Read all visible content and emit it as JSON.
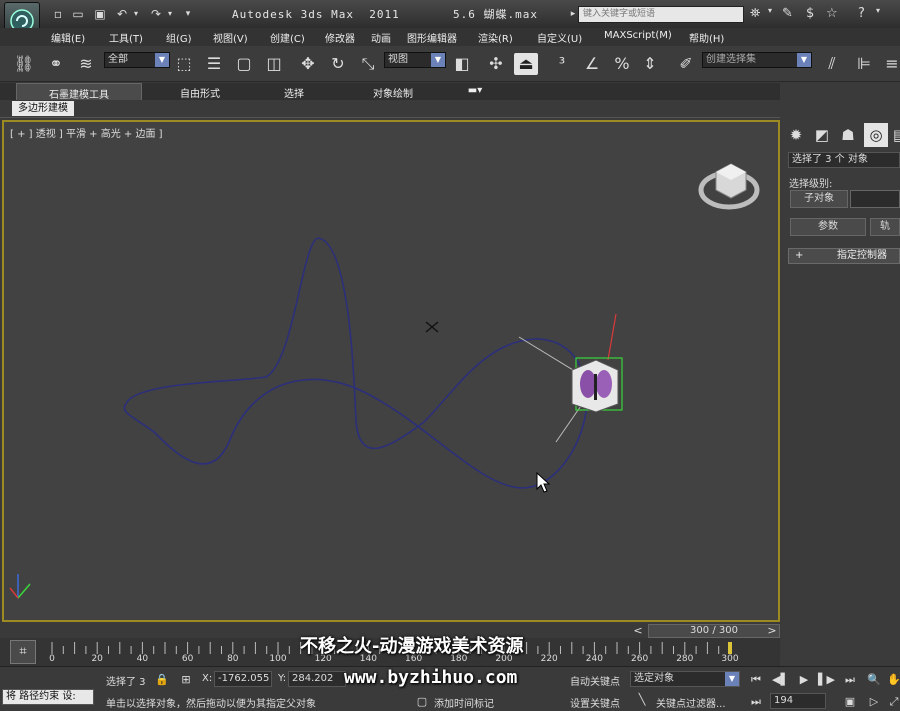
{
  "window": {
    "title": "Autodesk 3ds Max  2011       5.6 蝴蝶.max",
    "search_placeholder": "键入关键字或短语"
  },
  "menubar": [
    "编辑(E)",
    "工具(T)",
    "组(G)",
    "视图(V)",
    "创建(C)",
    "修改器",
    "动画",
    "图形编辑器",
    "渲染(R)",
    "自定义(U)",
    "MAXScript(M)",
    "帮助(H)"
  ],
  "toolbar": {
    "filter_value": "全部",
    "refcoord_value": "视图",
    "selection_set_placeholder": "创建选择集"
  },
  "ribbon": {
    "tabs": [
      "石墨建模工具",
      "自由形式",
      "选择",
      "对象绘制"
    ],
    "subtab": "多边形建模"
  },
  "viewport": {
    "label": "[ + ] 透视 ] 平滑 + 高光 + 边面 ]"
  },
  "command_panel": {
    "selection_text": "选择了 3 个 对象",
    "sublevel_label": "选择级别:",
    "subobject_button": "子对象",
    "params_button": "参数",
    "track_button": "轨",
    "rollout_title": "指定控制器"
  },
  "timeline": {
    "frame_display": "300 / 300",
    "ticks": [
      "0",
      "20",
      "40",
      "60",
      "80",
      "100",
      "120",
      "140",
      "160",
      "180",
      "200",
      "220",
      "240",
      "260",
      "280",
      "300"
    ]
  },
  "status": {
    "maxscript_text": "将 路径约束 设:",
    "selected_text": "选择了 3",
    "x_label": "X:",
    "x_value": "-1762.055",
    "y_label": "Y:",
    "y_value": "284.202",
    "prompt_text": "单击以选择对象，然后拖动以便为其指定父对象",
    "add_time_tag": "添加时间标记",
    "auto_key": "自动关键点",
    "set_key": "设置关键点",
    "selected_objects": "选定对象",
    "key_filters": "关键点过滤器...",
    "current_frame": "194"
  },
  "watermark": {
    "line1": "不移之火-动漫游戏美术资源",
    "line2": "www.byzhihuo.com"
  },
  "colors": {
    "viewport_border": "#9c8a22",
    "path_spline": "#2c2f7a",
    "selection_box": "#38d638",
    "axis_x": "#d93a3a",
    "axis_y": "#3ad93a",
    "axis_z": "#3a6ad9"
  }
}
